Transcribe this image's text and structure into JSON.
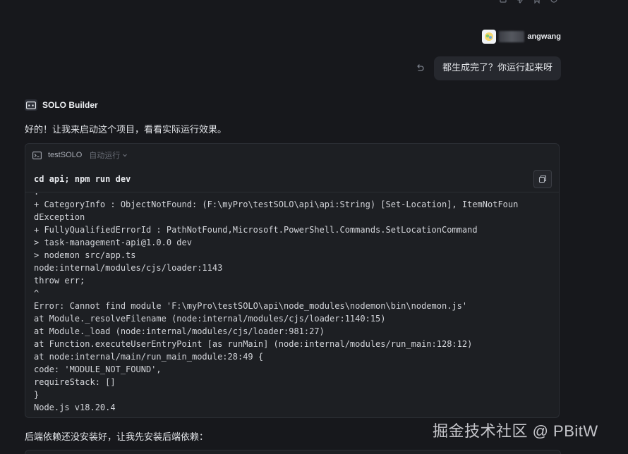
{
  "user": {
    "name_visible": "angwang",
    "message": "都生成完了？你运行起来呀"
  },
  "agent": {
    "name": "SOLO Builder",
    "intro": "好的！让我来启动这个项目，看看实际运行效果。",
    "followup": "后端依赖还没安装好，让我先安装后端依赖："
  },
  "terminal": {
    "title": "testSOLO",
    "mode": "自动运行",
    "command": "cd api; npm run dev",
    "output": [
      ".",
      "+ CategoryInfo : ObjectNotFound: (F:\\myPro\\testSOLO\\api\\api:String) [Set-Location], ItemNotFoun",
      "dException",
      "+ FullyQualifiedErrorId : PathNotFound,Microsoft.PowerShell.Commands.SetLocationCommand",
      "> task-management-api@1.0.0 dev",
      "> nodemon src/app.ts",
      "node:internal/modules/cjs/loader:1143",
      "throw err;",
      "^",
      "Error: Cannot find module 'F:\\myPro\\testSOLO\\api\\node_modules\\nodemon\\bin\\nodemon.js'",
      "at Module._resolveFilename (node:internal/modules/cjs/loader:1140:15)",
      "at Module._load (node:internal/modules/cjs/loader:981:27)",
      "at Function.executeUserEntryPoint [as runMain] (node:internal/modules/run_main:128:12)",
      "at node:internal/main/run_main_module:28:49 {",
      "code: 'MODULE_NOT_FOUND',",
      "requireStack: []",
      "}",
      "Node.js v18.20.4"
    ]
  },
  "watermark": "掘金技术社区 @ PBitW",
  "icons": {
    "top_actions": [
      "copy-icon",
      "thumbs-down-icon",
      "bookmark-icon",
      "refresh-icon"
    ],
    "undo": "undo-icon",
    "terminal": "terminal-icon",
    "chevron": "chevron-down-icon",
    "copy": "copy-icon"
  }
}
